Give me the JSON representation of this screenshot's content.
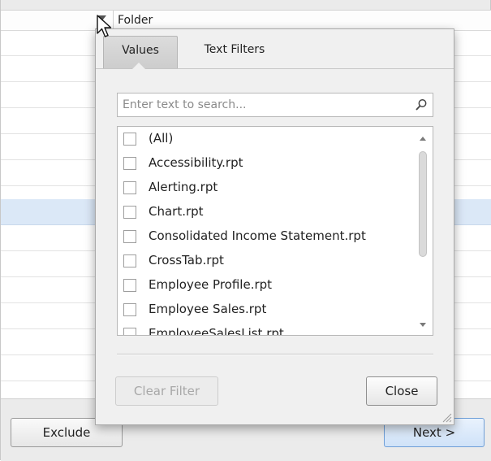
{
  "grid": {
    "column_header": "Folder"
  },
  "window_buttons": {
    "exclude_label": "Exclude",
    "next_label": "Next >"
  },
  "filter_popup": {
    "tabs": [
      {
        "label": "Values",
        "active": true
      },
      {
        "label": "Text Filters",
        "active": false
      }
    ],
    "search": {
      "placeholder": "Enter text to search...",
      "value": ""
    },
    "items": [
      {
        "label": "(All)",
        "checked": false
      },
      {
        "label": "Accessibility.rpt",
        "checked": false
      },
      {
        "label": "Alerting.rpt",
        "checked": false
      },
      {
        "label": "Chart.rpt",
        "checked": false
      },
      {
        "label": "Consolidated Income Statement.rpt",
        "checked": false
      },
      {
        "label": "CrossTab.rpt",
        "checked": false
      },
      {
        "label": "Employee Profile.rpt",
        "checked": false
      },
      {
        "label": "Employee Sales.rpt",
        "checked": false
      },
      {
        "label": "EmployeeSalesList.rpt",
        "checked": false
      }
    ],
    "clear_filter_label": "Clear Filter",
    "close_label": "Close"
  },
  "icons": {
    "filter": "filter-icon",
    "search": "search-icon",
    "resize": "resize-grip-icon",
    "cursor": "mouse-cursor-icon"
  },
  "colors": {
    "selected_row": "#dbe8f7",
    "next_button_accent": "#6f9fd8"
  }
}
